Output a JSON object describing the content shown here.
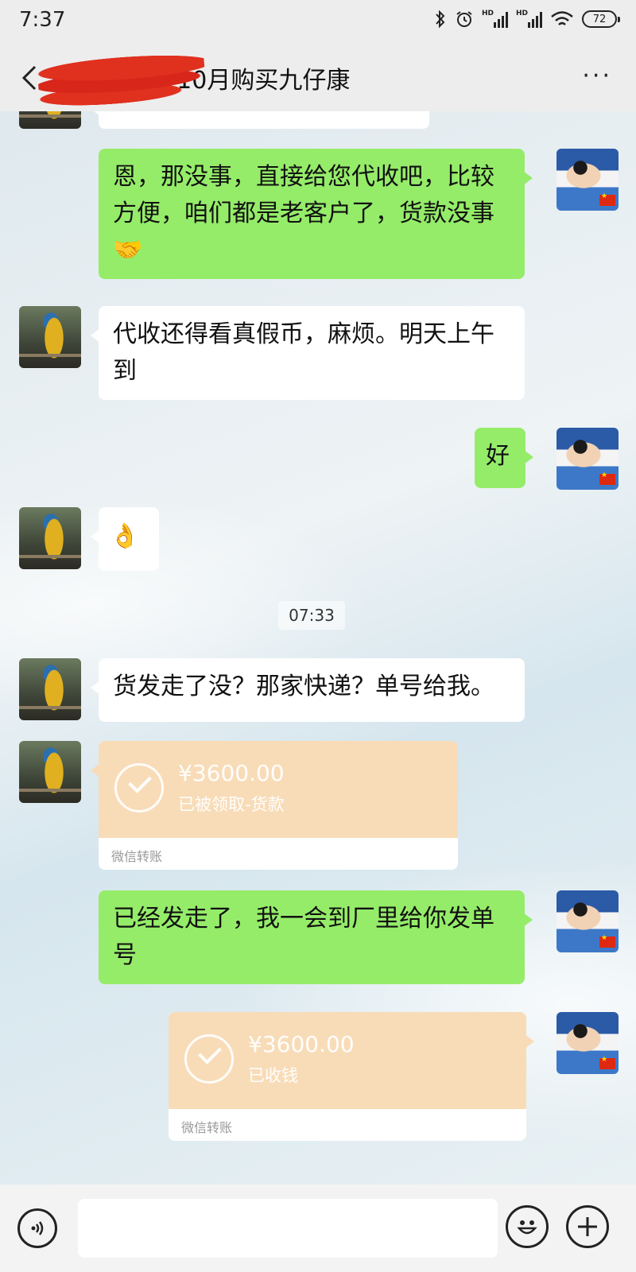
{
  "status_bar": {
    "time": "7:37",
    "battery": "72",
    "hd_label": "HD",
    "icons": [
      "bluetooth-icon",
      "alarm-icon",
      "signal-icon",
      "signal-icon",
      "wifi-icon",
      "battery-icon"
    ]
  },
  "nav": {
    "title": "张家新18年10月购买九仔康",
    "more": "···",
    "back_icon": "chevron-left-icon",
    "redaction_color": "#e0301e"
  },
  "messages": [
    {
      "side": "right",
      "type": "text",
      "text": "恩，那没事，直接给您代收吧，比较方便，咱们都是老客户了，货款没事",
      "emoji": "🤝"
    },
    {
      "side": "left",
      "type": "text",
      "text": "代收还得看真假币，麻烦。明天上午到"
    },
    {
      "side": "right",
      "type": "text",
      "text": "好"
    },
    {
      "side": "left",
      "type": "emoji",
      "emoji": "👌"
    },
    {
      "type": "time",
      "text": "07:33"
    },
    {
      "side": "left",
      "type": "text",
      "text": "货发走了没？那家快递？单号给我。"
    },
    {
      "side": "left",
      "type": "transfer",
      "amount": "¥3600.00",
      "status": "已被领取-货款",
      "footer": "微信转账"
    },
    {
      "side": "right",
      "type": "text",
      "text": "已经发走了，我一会到厂里给你发单号"
    },
    {
      "side": "right",
      "type": "transfer",
      "amount": "¥3600.00",
      "status": "已收钱",
      "footer": "微信转账"
    }
  ],
  "input_bar": {
    "placeholder": "",
    "voice_icon": "voice-icon",
    "emoji_icon": "smiley-icon",
    "plus_icon": "plus-icon"
  },
  "colors": {
    "sent_bubble": "#95ec69",
    "received_bubble": "#ffffff",
    "transfer_card": "#f8dcb8",
    "bar_background": "#ededed"
  }
}
